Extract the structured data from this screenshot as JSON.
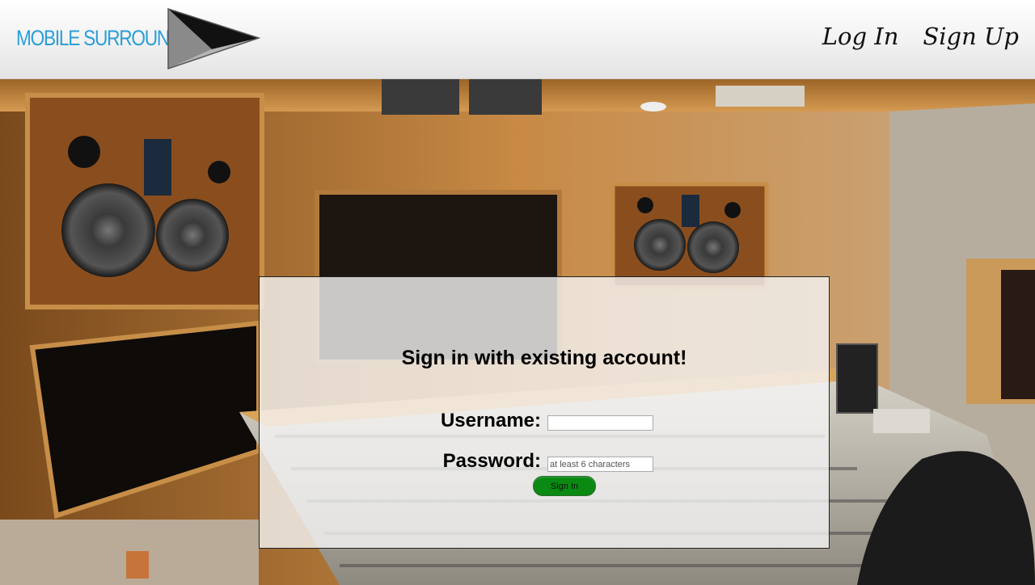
{
  "header": {
    "brand": "MOBILE SURROUND",
    "nav": [
      {
        "label": "Log In"
      },
      {
        "label": "Sign Up"
      }
    ]
  },
  "signin": {
    "title": "Sign in with existing account!",
    "username_label": "Username:",
    "username_value": "",
    "password_label": "Password:",
    "password_placeholder": "at least 6 characters",
    "button_label": "Sign In"
  },
  "colors": {
    "brand": "#2a9fd8",
    "button": "#0a8a12",
    "wood": "#c58a3e"
  }
}
